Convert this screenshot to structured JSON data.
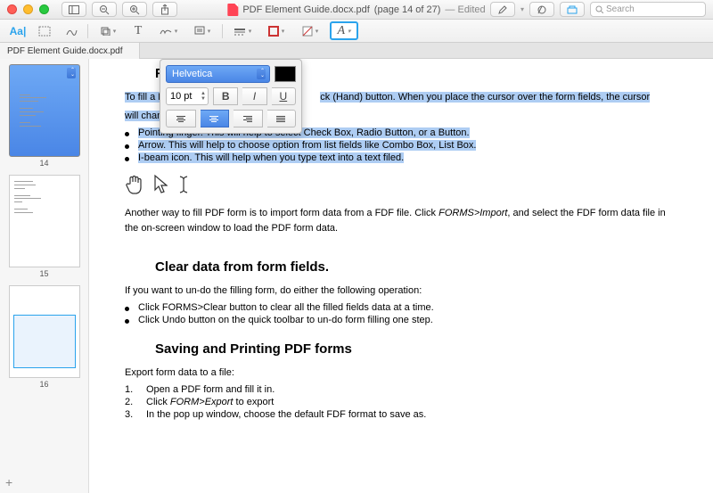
{
  "title": {
    "filename": "PDF Element Guide.docx.pdf",
    "pager": "(page 14 of 27)",
    "status": "— Edited"
  },
  "tab": {
    "label": "PDF Element Guide.docx.pdf"
  },
  "search": {
    "placeholder": "Search"
  },
  "thumbs": {
    "p14": "14",
    "p15": "15",
    "p16": "16"
  },
  "popover": {
    "font": "Helvetica",
    "size": "10 pt",
    "bold": "B",
    "italic": "I",
    "underline": "U"
  },
  "doc": {
    "h_fill": "Fill",
    "p1a": "To fill a PDF",
    "p1b": "ck (Hand) button. When you place the cursor over the form fields, the cursor",
    "p1c": "will change t",
    "b1": "Pointing finger. This will help to select Check Box, Radio Button, or a Button.",
    "b2": "Arrow. This will help to choose option from list fields like Combo Box, List Box.",
    "b3": "I-beam icon. This will help when you type text into a text filed.",
    "p2a": "Another way to fill PDF form is to import form data from a FDF file. Click ",
    "p2b": "FORMS>Import",
    "p2c": ", and select the FDF form data file in the on-screen window to load the PDF form data.",
    "h_clear": "Clear data from form fields.",
    "p3": "If you want to un-do the filling form, do either the following operation:",
    "c1": "Click FORMS>Clear button to clear all the filled fields data at a time.",
    "c2": "Click Undo button on the quick toolbar to un-do form filling one step.",
    "h_save": "Saving and Printing PDF forms",
    "p4": "Export form data to a file:",
    "n1": "Open a PDF form and fill it in.",
    "n2a": "Click ",
    "n2b": "FORM>Export",
    "n2c": " to export",
    "n3": "In the pop up window, choose the default FDF format to save as."
  }
}
